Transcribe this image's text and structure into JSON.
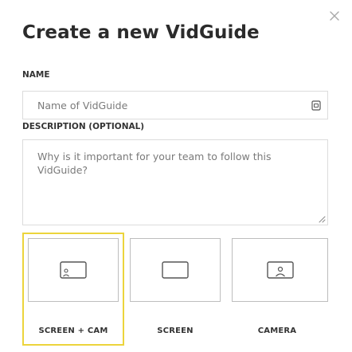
{
  "dialog": {
    "title": "Create a new VidGuide",
    "close_icon": "close-icon"
  },
  "name_field": {
    "label": "NAME",
    "placeholder": "Name of VidGuide",
    "value": "",
    "icon": "password-manager-icon"
  },
  "description_field": {
    "label": "DESCRIPTION (OPTIONAL)",
    "placeholder": "Why is it important for your team to follow this VidGuide?",
    "value": ""
  },
  "modes": [
    {
      "label": "SCREEN + CAM",
      "icon": "screen-with-camera-icon",
      "selected": true
    },
    {
      "label": "SCREEN",
      "icon": "screen-icon",
      "selected": false
    },
    {
      "label": "CAMERA",
      "icon": "camera-icon",
      "selected": false
    }
  ],
  "colors": {
    "selected_border": "#ecd43c",
    "text": "#333333",
    "placeholder": "#7a7a7a",
    "field_border": "#dcdcdc"
  }
}
